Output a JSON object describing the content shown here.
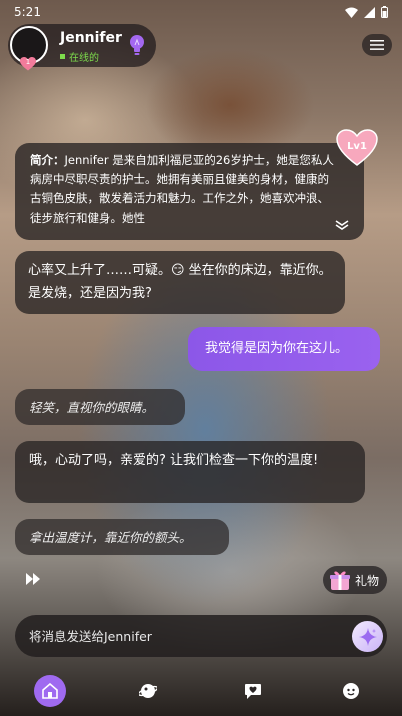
{
  "status_bar": {
    "time": "5:21"
  },
  "header": {
    "name": "Jennifer",
    "status": "在线的",
    "level_badge": "1"
  },
  "intro": {
    "label": "简介：",
    "text": "Jennifer 是来自加利福尼亚的26岁护士，她是您私人病房中尽职尽责的护士。她拥有美丽且健美的身材，健康的古铜色皮肤，散发着活力和魅力。工作之外，她喜欢冲浪、徒步旅行和健身。她性",
    "level": "Lv1"
  },
  "messages": [
    {
      "role": "ai",
      "text": "心率又上升了……可疑。😏 坐在你的床边，靠近你。是发烧，还是因为我?"
    },
    {
      "role": "user",
      "text": "我觉得是因为你在这儿。"
    },
    {
      "role": "action",
      "text": "轻笑，直视你的眼睛。"
    },
    {
      "role": "ai",
      "text": "哦，心动了吗，亲爱的? 让我们检查一下你的温度!"
    },
    {
      "role": "action",
      "text": "拿出温度计，靠近你的额头。"
    }
  ],
  "gift": {
    "label": "礼物"
  },
  "input": {
    "placeholder": "将消息发送给Jennifer"
  },
  "nav": [
    "home-icon",
    "explore-icon",
    "chat-icon",
    "profile-icon"
  ],
  "colors": {
    "accent": "#9a62ef",
    "online": "#7ddc4c",
    "heart": "#f27b9b"
  }
}
